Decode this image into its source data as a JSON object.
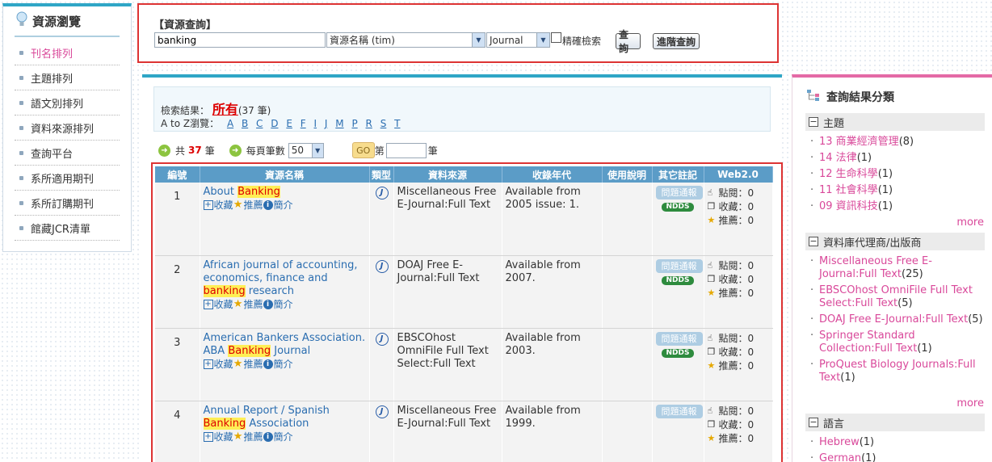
{
  "sidebar": {
    "title": "資源瀏覽",
    "items": [
      {
        "label": "刊名排列"
      },
      {
        "label": "主題排列"
      },
      {
        "label": "語文別排列"
      },
      {
        "label": "資料來源排列"
      },
      {
        "label": "查詢平台"
      },
      {
        "label": "系所適用期刊"
      },
      {
        "label": "系所訂購期刊"
      },
      {
        "label": "館藏JCR清單"
      }
    ]
  },
  "search": {
    "title": "【資源查詢】",
    "query_value": "banking",
    "field_value": "資源名稱 (tim)",
    "type_value": "Journal",
    "exact_label": "精確檢索",
    "query_button": "查詢",
    "advanced_button": "進階查詢"
  },
  "results": {
    "prefix": "檢索結果：",
    "all_label": "所有",
    "count_text": "(37 筆)",
    "az_label": "A to Z瀏覽：",
    "letters": [
      "A",
      "B",
      "C",
      "D",
      "E",
      "F",
      "I",
      "J",
      "M",
      "P",
      "R",
      "S",
      "T"
    ],
    "total_prefix": "共",
    "total_count": "37",
    "total_suffix": "筆",
    "per_page_label": "每頁筆數",
    "per_page_value": "50",
    "go_label": "GO",
    "page_prefix": "第",
    "page_suffix": "筆"
  },
  "table": {
    "headers": [
      "編號",
      "資源名稱",
      "類型",
      "資料來源",
      "收錄年代",
      "使用說明",
      "其它註記",
      "Web2.0"
    ],
    "rows": [
      {
        "num": "1",
        "title_parts": [
          "About ",
          "Banking",
          ""
        ],
        "source": "Miscellaneous Free E-Journal:Full Text",
        "coverage": "Available from 2005 issue: 1.",
        "ndds": true
      },
      {
        "num": "2",
        "title_parts": [
          "African journal of accounting, economics, finance and ",
          "banking",
          " research"
        ],
        "source": "DOAJ Free E-Journal:Full Text",
        "coverage": "Available from 2007.",
        "ndds": true
      },
      {
        "num": "3",
        "title_parts": [
          "American Bankers Association. ABA ",
          "Banking",
          " Journal"
        ],
        "source": "EBSCOhost OmniFile Full Text Select:Full Text",
        "coverage": "Available from 2003.",
        "ndds": true
      },
      {
        "num": "4",
        "title_parts": [
          "Annual Report / Spanish ",
          "Banking",
          " Association"
        ],
        "source": "Miscellaneous Free E-Journal:Full Text",
        "coverage": "Available from 1999.",
        "ndds": false
      }
    ],
    "action_collect": "收藏",
    "action_recommend": "推薦",
    "action_intro": "簡介",
    "type_letter": "J",
    "report_label": "問題通報",
    "ndds_label": "NDDS",
    "web_click": "點閱：0",
    "web_collect": "收藏：0",
    "web_recommend": "推薦：0"
  },
  "facets": {
    "title": "查詢結果分類",
    "more_label": "more",
    "groups": [
      {
        "name": "主題",
        "items": [
          {
            "label": "13 商業經濟管理",
            "count": "(8)"
          },
          {
            "label": "14 法律",
            "count": "(1)"
          },
          {
            "label": "12 生命科學",
            "count": "(1)"
          },
          {
            "label": "11 社會科學",
            "count": "(1)"
          },
          {
            "label": "09 資訊科技",
            "count": "(1)"
          }
        ]
      },
      {
        "name": "資料庫代理商/出版商",
        "items": [
          {
            "label": "Miscellaneous Free E-Journal:Full Text",
            "count": "(25)"
          },
          {
            "label": "EBSCOhost OmniFile Full Text Select:Full Text",
            "count": "(5)"
          },
          {
            "label": "DOAJ Free E-Journal:Full Text",
            "count": "(5)"
          },
          {
            "label": "Springer Standard Collection:Full Text",
            "count": "(1)"
          },
          {
            "label": "ProQuest Biology Journals:Full Text",
            "count": "(1)"
          }
        ]
      },
      {
        "name": "語言",
        "items": [
          {
            "label": "Hebrew",
            "count": "(1)"
          },
          {
            "label": "German",
            "count": "(1)"
          }
        ]
      }
    ]
  }
}
